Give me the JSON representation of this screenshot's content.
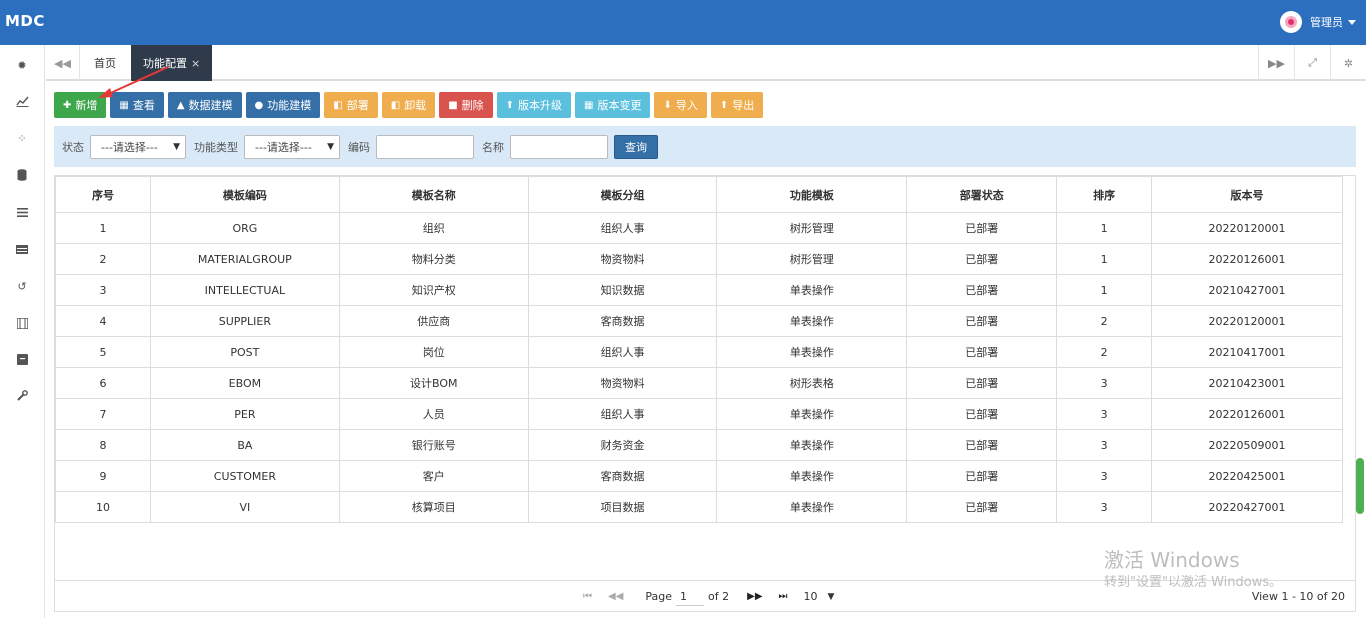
{
  "app": {
    "logo": "MDC",
    "user_name": "管理员"
  },
  "tabs": {
    "home": "首页",
    "active": "功能配置",
    "close": "×"
  },
  "toolbar": {
    "add": "新增",
    "view": "查看",
    "data_model": "数据建模",
    "func_model": "功能建模",
    "deploy": "部署",
    "undeploy": "卸载",
    "delete": "删除",
    "upgrade": "版本升级",
    "change": "版本变更",
    "import": "导入",
    "export": "导出"
  },
  "filter": {
    "status_label": "状态",
    "status_value": "---请选择---",
    "type_label": "功能类型",
    "type_value": "---请选择---",
    "code_label": "编码",
    "code_value": "",
    "name_label": "名称",
    "name_value": "",
    "query": "查询"
  },
  "table": {
    "headers": [
      "序号",
      "模板编码",
      "模板名称",
      "模板分组",
      "功能模板",
      "部署状态",
      "排序",
      "版本号"
    ],
    "rows": [
      [
        "1",
        "ORG",
        "组织",
        "组织人事",
        "树形管理",
        "已部署",
        "1",
        "20220120001"
      ],
      [
        "2",
        "MATERIALGROUP",
        "物料分类",
        "物资物料",
        "树形管理",
        "已部署",
        "1",
        "20220126001"
      ],
      [
        "3",
        "INTELLECTUAL",
        "知识产权",
        "知识数据",
        "单表操作",
        "已部署",
        "1",
        "20210427001"
      ],
      [
        "4",
        "SUPPLIER",
        "供应商",
        "客商数据",
        "单表操作",
        "已部署",
        "2",
        "20220120001"
      ],
      [
        "5",
        "POST",
        "岗位",
        "组织人事",
        "单表操作",
        "已部署",
        "2",
        "20210417001"
      ],
      [
        "6",
        "EBOM",
        "设计BOM",
        "物资物料",
        "树形表格",
        "已部署",
        "3",
        "20210423001"
      ],
      [
        "7",
        "PER",
        "人员",
        "组织人事",
        "单表操作",
        "已部署",
        "3",
        "20220126001"
      ],
      [
        "8",
        "BA",
        "银行账号",
        "财务资金",
        "单表操作",
        "已部署",
        "3",
        "20220509001"
      ],
      [
        "9",
        "CUSTOMER",
        "客户",
        "客商数据",
        "单表操作",
        "已部署",
        "3",
        "20220425001"
      ],
      [
        "10",
        "VI",
        "核算项目",
        "项目数据",
        "单表操作",
        "已部署",
        "3",
        "20220427001"
      ]
    ]
  },
  "pager": {
    "page_label": "Page",
    "page_value": "1",
    "of_label": "of 2",
    "page_size": "10",
    "view_info": "View 1 - 10 of 20"
  },
  "watermark": {
    "line1": "激活 Windows",
    "line2": "转到\"设置\"以激活 Windows。"
  },
  "colors": {
    "topbar": "#2d6fbf",
    "filter_bg": "#d9e9f7",
    "green": "#3ea74c",
    "blue": "#346fa8",
    "orange": "#f0ad4e",
    "red": "#d9534f",
    "cyan": "#5bc0de"
  }
}
